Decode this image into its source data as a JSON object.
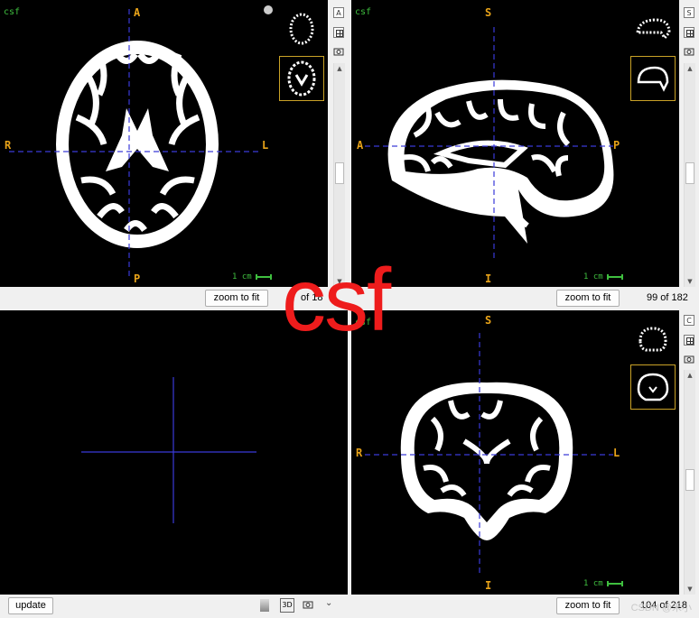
{
  "volume_name": "csf",
  "views": {
    "axial": {
      "name": "csf",
      "labels": {
        "top": "A",
        "bottom": "P",
        "left": "R",
        "right": "L"
      },
      "scale": "1 cm",
      "slice_text": "of 18",
      "side_button": "A"
    },
    "sagittal": {
      "name": "csf",
      "labels": {
        "top": "S",
        "bottom": "I",
        "left": "A",
        "right": "P"
      },
      "scale": "1 cm",
      "slice_text": "99 of 182",
      "side_button": "S"
    },
    "coronal": {
      "name": "csf",
      "labels": {
        "top": "S",
        "bottom": "I",
        "left": "R",
        "right": "L"
      },
      "scale": "1 cm",
      "slice_text": "104 of 218",
      "side_button": "C"
    },
    "render3d": {
      "toolbar_3d_label": "3D"
    }
  },
  "buttons": {
    "zoom_to_fit": "zoom to fit",
    "update": "update"
  },
  "watermark": "csf",
  "credit": "CSDN @禾小"
}
